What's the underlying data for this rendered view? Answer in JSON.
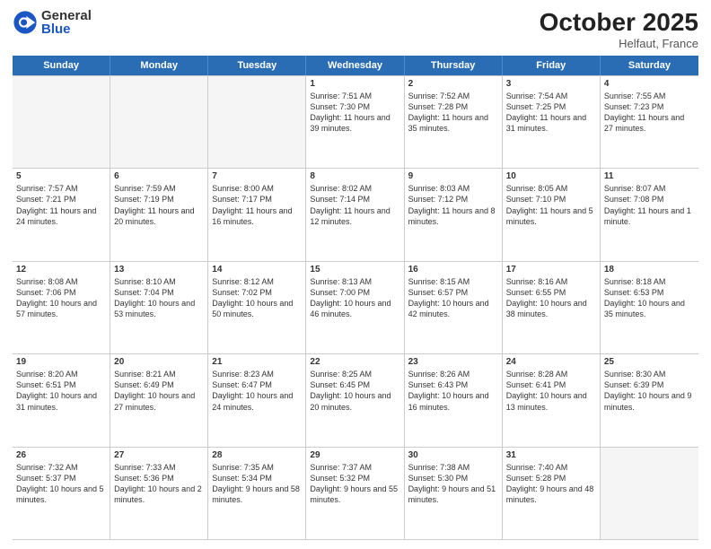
{
  "logo": {
    "general": "General",
    "blue": "Blue"
  },
  "title": "October 2025",
  "location": "Helfaut, France",
  "days": [
    "Sunday",
    "Monday",
    "Tuesday",
    "Wednesday",
    "Thursday",
    "Friday",
    "Saturday"
  ],
  "rows": [
    [
      {
        "day": "",
        "empty": true
      },
      {
        "day": "",
        "empty": true
      },
      {
        "day": "",
        "empty": true
      },
      {
        "day": "1",
        "sunrise": "Sunrise: 7:51 AM",
        "sunset": "Sunset: 7:30 PM",
        "daylight": "Daylight: 11 hours and 39 minutes."
      },
      {
        "day": "2",
        "sunrise": "Sunrise: 7:52 AM",
        "sunset": "Sunset: 7:28 PM",
        "daylight": "Daylight: 11 hours and 35 minutes."
      },
      {
        "day": "3",
        "sunrise": "Sunrise: 7:54 AM",
        "sunset": "Sunset: 7:25 PM",
        "daylight": "Daylight: 11 hours and 31 minutes."
      },
      {
        "day": "4",
        "sunrise": "Sunrise: 7:55 AM",
        "sunset": "Sunset: 7:23 PM",
        "daylight": "Daylight: 11 hours and 27 minutes."
      }
    ],
    [
      {
        "day": "5",
        "sunrise": "Sunrise: 7:57 AM",
        "sunset": "Sunset: 7:21 PM",
        "daylight": "Daylight: 11 hours and 24 minutes."
      },
      {
        "day": "6",
        "sunrise": "Sunrise: 7:59 AM",
        "sunset": "Sunset: 7:19 PM",
        "daylight": "Daylight: 11 hours and 20 minutes."
      },
      {
        "day": "7",
        "sunrise": "Sunrise: 8:00 AM",
        "sunset": "Sunset: 7:17 PM",
        "daylight": "Daylight: 11 hours and 16 minutes."
      },
      {
        "day": "8",
        "sunrise": "Sunrise: 8:02 AM",
        "sunset": "Sunset: 7:14 PM",
        "daylight": "Daylight: 11 hours and 12 minutes."
      },
      {
        "day": "9",
        "sunrise": "Sunrise: 8:03 AM",
        "sunset": "Sunset: 7:12 PM",
        "daylight": "Daylight: 11 hours and 8 minutes."
      },
      {
        "day": "10",
        "sunrise": "Sunrise: 8:05 AM",
        "sunset": "Sunset: 7:10 PM",
        "daylight": "Daylight: 11 hours and 5 minutes."
      },
      {
        "day": "11",
        "sunrise": "Sunrise: 8:07 AM",
        "sunset": "Sunset: 7:08 PM",
        "daylight": "Daylight: 11 hours and 1 minute."
      }
    ],
    [
      {
        "day": "12",
        "sunrise": "Sunrise: 8:08 AM",
        "sunset": "Sunset: 7:06 PM",
        "daylight": "Daylight: 10 hours and 57 minutes."
      },
      {
        "day": "13",
        "sunrise": "Sunrise: 8:10 AM",
        "sunset": "Sunset: 7:04 PM",
        "daylight": "Daylight: 10 hours and 53 minutes."
      },
      {
        "day": "14",
        "sunrise": "Sunrise: 8:12 AM",
        "sunset": "Sunset: 7:02 PM",
        "daylight": "Daylight: 10 hours and 50 minutes."
      },
      {
        "day": "15",
        "sunrise": "Sunrise: 8:13 AM",
        "sunset": "Sunset: 7:00 PM",
        "daylight": "Daylight: 10 hours and 46 minutes."
      },
      {
        "day": "16",
        "sunrise": "Sunrise: 8:15 AM",
        "sunset": "Sunset: 6:57 PM",
        "daylight": "Daylight: 10 hours and 42 minutes."
      },
      {
        "day": "17",
        "sunrise": "Sunrise: 8:16 AM",
        "sunset": "Sunset: 6:55 PM",
        "daylight": "Daylight: 10 hours and 38 minutes."
      },
      {
        "day": "18",
        "sunrise": "Sunrise: 8:18 AM",
        "sunset": "Sunset: 6:53 PM",
        "daylight": "Daylight: 10 hours and 35 minutes."
      }
    ],
    [
      {
        "day": "19",
        "sunrise": "Sunrise: 8:20 AM",
        "sunset": "Sunset: 6:51 PM",
        "daylight": "Daylight: 10 hours and 31 minutes."
      },
      {
        "day": "20",
        "sunrise": "Sunrise: 8:21 AM",
        "sunset": "Sunset: 6:49 PM",
        "daylight": "Daylight: 10 hours and 27 minutes."
      },
      {
        "day": "21",
        "sunrise": "Sunrise: 8:23 AM",
        "sunset": "Sunset: 6:47 PM",
        "daylight": "Daylight: 10 hours and 24 minutes."
      },
      {
        "day": "22",
        "sunrise": "Sunrise: 8:25 AM",
        "sunset": "Sunset: 6:45 PM",
        "daylight": "Daylight: 10 hours and 20 minutes."
      },
      {
        "day": "23",
        "sunrise": "Sunrise: 8:26 AM",
        "sunset": "Sunset: 6:43 PM",
        "daylight": "Daylight: 10 hours and 16 minutes."
      },
      {
        "day": "24",
        "sunrise": "Sunrise: 8:28 AM",
        "sunset": "Sunset: 6:41 PM",
        "daylight": "Daylight: 10 hours and 13 minutes."
      },
      {
        "day": "25",
        "sunrise": "Sunrise: 8:30 AM",
        "sunset": "Sunset: 6:39 PM",
        "daylight": "Daylight: 10 hours and 9 minutes."
      }
    ],
    [
      {
        "day": "26",
        "sunrise": "Sunrise: 7:32 AM",
        "sunset": "Sunset: 5:37 PM",
        "daylight": "Daylight: 10 hours and 5 minutes."
      },
      {
        "day": "27",
        "sunrise": "Sunrise: 7:33 AM",
        "sunset": "Sunset: 5:36 PM",
        "daylight": "Daylight: 10 hours and 2 minutes."
      },
      {
        "day": "28",
        "sunrise": "Sunrise: 7:35 AM",
        "sunset": "Sunset: 5:34 PM",
        "daylight": "Daylight: 9 hours and 58 minutes."
      },
      {
        "day": "29",
        "sunrise": "Sunrise: 7:37 AM",
        "sunset": "Sunset: 5:32 PM",
        "daylight": "Daylight: 9 hours and 55 minutes."
      },
      {
        "day": "30",
        "sunrise": "Sunrise: 7:38 AM",
        "sunset": "Sunset: 5:30 PM",
        "daylight": "Daylight: 9 hours and 51 minutes."
      },
      {
        "day": "31",
        "sunrise": "Sunrise: 7:40 AM",
        "sunset": "Sunset: 5:28 PM",
        "daylight": "Daylight: 9 hours and 48 minutes."
      },
      {
        "day": "",
        "empty": true
      }
    ]
  ]
}
